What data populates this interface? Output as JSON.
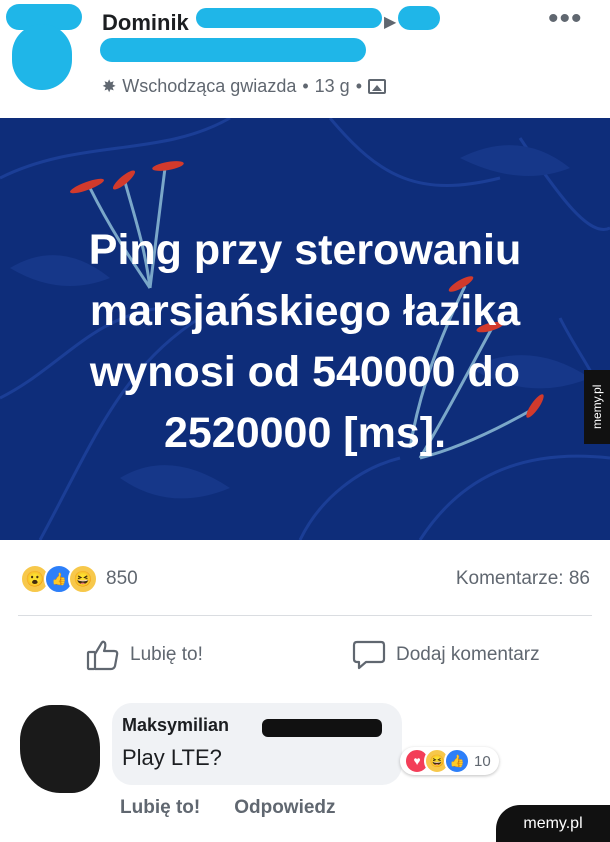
{
  "post": {
    "author_name": "Dominik",
    "more_icon": "more-dots-icon",
    "meta": {
      "badge_icon": "rising-star-icon",
      "badge": "Wschodząca gwiazda",
      "separator": "•",
      "time": "13 g",
      "privacy_icon": "photo-icon"
    },
    "banner": {
      "background": "#0e2d7a",
      "lines": [
        "Ping przy sterowaniu",
        "marsjańskiego łazika",
        "wynosi od 540000 do",
        "2520000 [ms]."
      ]
    },
    "watermark_side": "memy.pl"
  },
  "stats": {
    "reaction_icons": [
      "wow-icon",
      "like-icon",
      "haha-icon"
    ],
    "reactions_count": "850",
    "comments": "Komentarze: 86"
  },
  "actions": {
    "like_label": "Lubię to!",
    "comment_label": "Dodaj komentarz"
  },
  "comment": {
    "author": "Maksymilian",
    "text": "Play LTE?",
    "reactions_count": "10",
    "like_label": "Lubię to!",
    "reply_label": "Odpowiedz"
  },
  "watermark": "memy.pl",
  "colors": {
    "accent": "#1877f2",
    "scribble": "#1fb6e8",
    "text_secondary": "#606770"
  }
}
